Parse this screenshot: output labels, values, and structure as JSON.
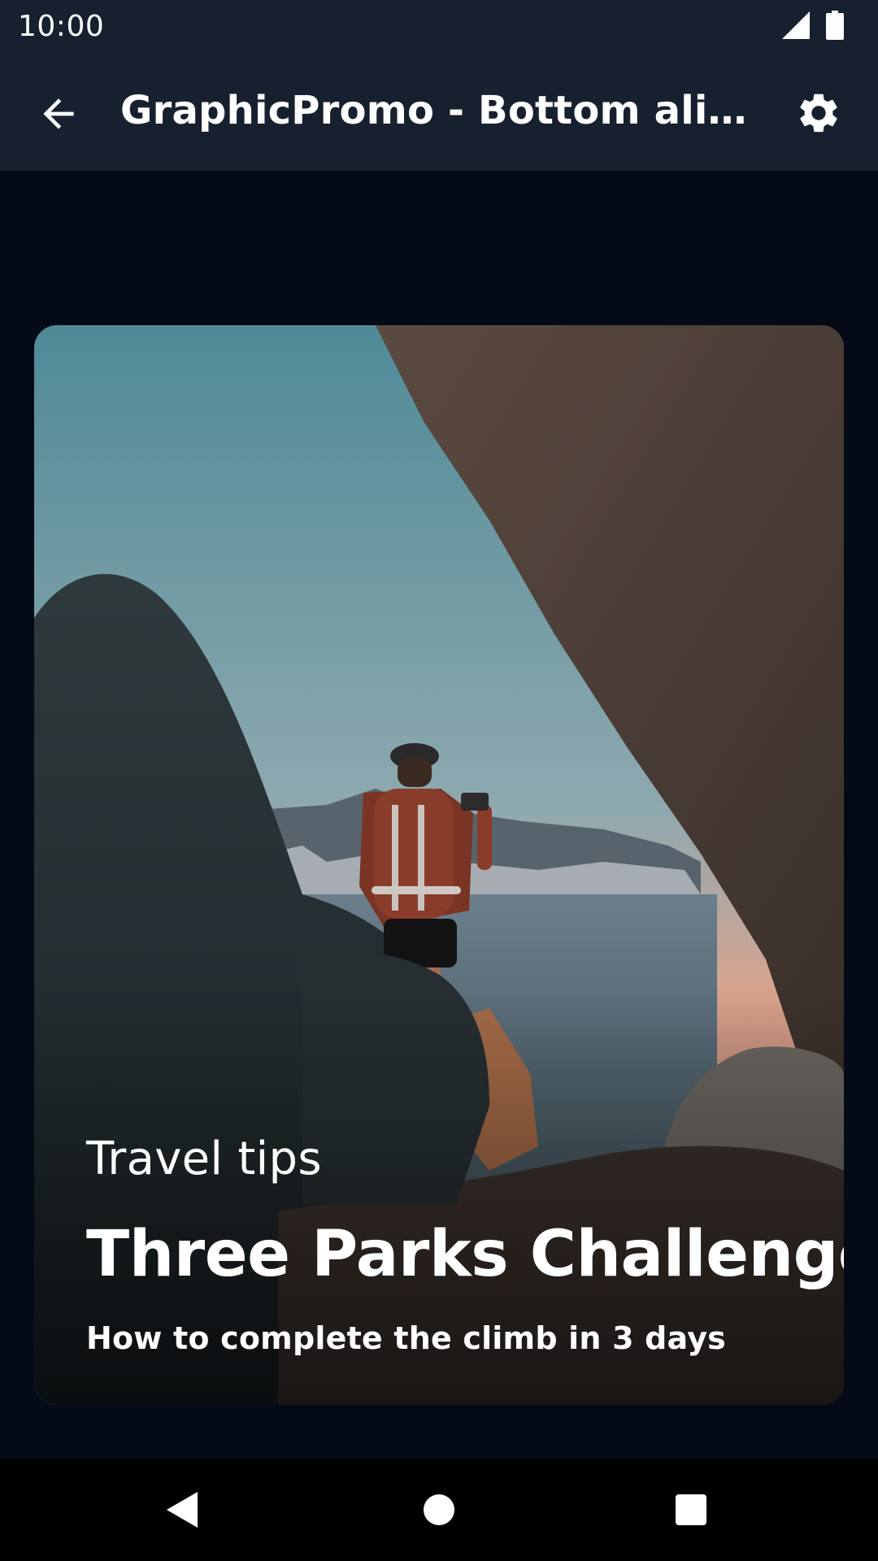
{
  "status_bar": {
    "time": "10:00",
    "icons": [
      "signal-icon",
      "battery-icon"
    ]
  },
  "app_bar": {
    "title": "GraphicPromo - Bottom align w...",
    "back_icon": "arrow-back-icon",
    "settings_icon": "gear-icon"
  },
  "promo": {
    "eyebrow": "Travel tips",
    "headline": "Three Parks Challenge",
    "body": "How to complete the climb in 3 days"
  },
  "nav_bar": {
    "icons": [
      "back-triangle-icon",
      "home-circle-icon",
      "recents-square-icon"
    ]
  },
  "colors": {
    "app_bar": "#17202f",
    "background": "#050b16",
    "nav_bar": "#000000",
    "text": "#ffffff"
  }
}
